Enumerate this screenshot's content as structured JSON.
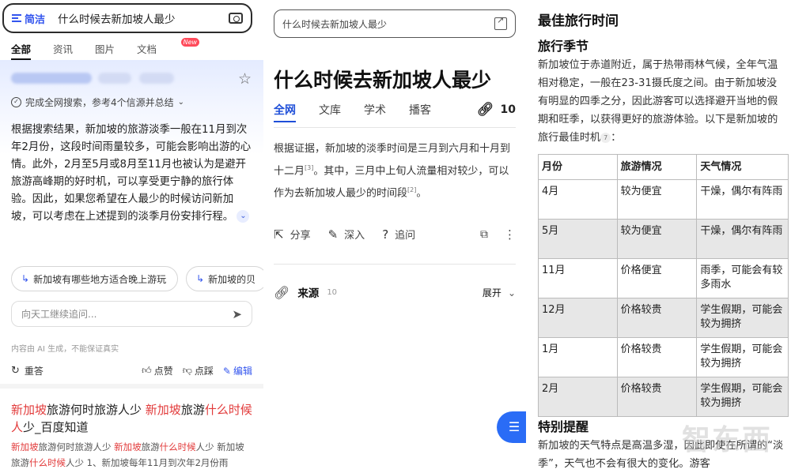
{
  "panel1": {
    "filter_label": "简洁",
    "query": "什么时候去新加坡人最少",
    "tabs": [
      "全部",
      "资讯",
      "图片",
      "文档"
    ],
    "new_badge": "New",
    "summary_note": "完成全网搜索，参考4个信源并总结",
    "answer": "根据搜索结果，新加坡的旅游淡季一般在11月到次年2月份，这段时间雨量较多，可能会影响出游的心情。此外，2月至5月或8月至11月也被认为是避开旅游高峰期的好时机，可以享受更宁静的旅行体验。因此，如果您希望在人最少的时候访问新加坡，可以考虑在上述提到的淡季月份安排行程。",
    "chips": [
      "新加坡有哪些地方适合晚上游玩",
      "新加坡的贝"
    ],
    "ask_placeholder": "向天工继续追问...",
    "ai_note": "内容由 AI 生成，不能保证真实",
    "actions": {
      "retry": "重答",
      "like": "点赞",
      "dislike": "点踩",
      "edit": "编辑"
    },
    "result": {
      "title_parts": [
        {
          "t": "新加坡",
          "hl": true
        },
        {
          "t": "旅游何时旅游人少 ",
          "hl": false
        },
        {
          "t": "新加坡",
          "hl": true
        },
        {
          "t": "旅游",
          "hl": false
        },
        {
          "t": "什么时候人",
          "hl": true
        },
        {
          "t": "少_百度知道",
          "hl": false
        }
      ],
      "snippet_parts": [
        {
          "t": "新加坡",
          "hl": true
        },
        {
          "t": "旅游何时旅游人少 ",
          "hl": false
        },
        {
          "t": "新加坡",
          "hl": true
        },
        {
          "t": "旅游",
          "hl": false
        },
        {
          "t": "什么时候",
          "hl": true
        },
        {
          "t": "人少 新加坡旅游",
          "hl": false
        },
        {
          "t": "什么时候",
          "hl": true
        },
        {
          "t": "人少 1、新加坡每年11月到次年2月份雨",
          "hl": false
        }
      ]
    }
  },
  "panel2": {
    "query": "什么时候去新加坡人最少",
    "title": "什么时候去新加坡人最少",
    "tabs": [
      "全网",
      "文库",
      "学术",
      "播客"
    ],
    "link_count": "10",
    "answer_a": "根据证据，新加坡的淡季时间是三月到六月和十月到十二月",
    "cite_a": "[3]",
    "answer_b": "。其中，三月中上旬人流量相对较少，可以作为去新加坡人最少的时间段",
    "cite_b": "[2]",
    "answer_c": "。",
    "actions": {
      "share": "分享",
      "deep": "深入",
      "ask": "追问"
    },
    "sources_label": "来源",
    "sources_count": "10",
    "expand_label": "展开"
  },
  "panel3": {
    "heading": "最佳旅行时间",
    "subheading": "旅行季节",
    "paragraph": "新加坡位于赤道附近，属于热带雨林气候，全年气温相对稳定，一般在23-31摄氏度之间。由于新加坡没有明显的四季之分，因此游客可以选择避开当地的假期和旺季，以获得更好的旅游体验。以下是新加坡的旅行最佳时机",
    "cite": "7",
    "colon": "：",
    "table": {
      "headers": [
        "月份",
        "旅游情况",
        "天气情况"
      ],
      "rows": [
        [
          "4月",
          "较为便宜",
          "干燥，偶尔有阵雨"
        ],
        [
          "5月",
          "较为便宜",
          "干燥，偶尔有阵雨"
        ],
        [
          "11月",
          "价格便宜",
          "雨季，可能会有较多雨水"
        ],
        [
          "12月",
          "价格较贵",
          "学生假期，可能会较为拥挤"
        ],
        [
          "1月",
          "价格较贵",
          "学生假期，可能会较为拥挤"
        ],
        [
          "2月",
          "价格较贵",
          "学生假期，可能会较为拥挤"
        ]
      ]
    },
    "subheading2": "特别提醒",
    "tail": "新加坡的天气特点是高温多湿，因此即使在所谓的“淡季”，天气也不会有很大的变化。游客",
    "watermark": "智东西"
  },
  "colors": {
    "accent_blue": "#3355ee",
    "highlight_red": "#e23b3b",
    "fab_blue": "#2a6cf6"
  }
}
